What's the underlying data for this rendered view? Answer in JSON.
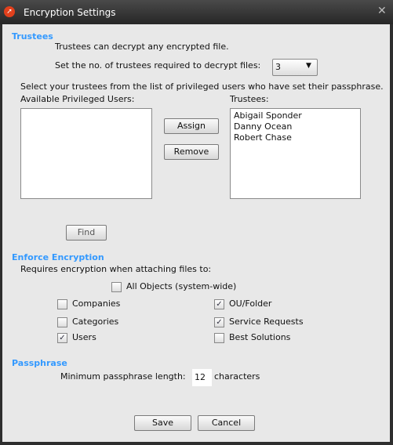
{
  "window": {
    "title": "Encryption Settings",
    "close": "✕"
  },
  "trustees": {
    "heading": "Trustees",
    "desc": "Trustees can decrypt any encrypted file.",
    "count_label": "Set the no. of trustees required to decrypt files:",
    "count_value": "3",
    "select_label": "Select your trustees from the list of privileged users who have set their passphrase.",
    "available_label": "Available Privileged Users:",
    "trustees_label": "Trustees:",
    "available_users": [],
    "selected_trustees": [
      "Abigail Sponder",
      "Danny Ocean",
      "Robert Chase"
    ],
    "assign": "Assign",
    "remove": "Remove",
    "find": "Find"
  },
  "enforce": {
    "heading": "Enforce Encryption",
    "desc": "Requires encryption when attaching files to:",
    "all_objects": {
      "label": "All Objects (system-wide)",
      "checked": false
    },
    "options": [
      {
        "label": "Companies",
        "checked": false
      },
      {
        "label": "Categories",
        "checked": false
      },
      {
        "label": "Users",
        "checked": true
      },
      {
        "label": "OU/Folder",
        "checked": true
      },
      {
        "label": "Service Requests",
        "checked": true
      },
      {
        "label": "Best Solutions",
        "checked": false
      }
    ]
  },
  "passphrase": {
    "heading": "Passphrase",
    "label": "Minimum passphrase length:",
    "value": "12",
    "unit": "characters"
  },
  "buttons": {
    "save": "Save",
    "cancel": "Cancel"
  }
}
